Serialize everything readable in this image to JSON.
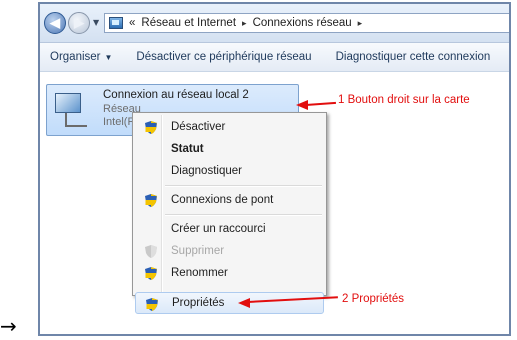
{
  "pointer_glyph": "→",
  "address_bar": {
    "prefix": "«",
    "crumbs": [
      "Réseau et Internet",
      "Connexions réseau"
    ],
    "separator": "▸"
  },
  "toolbar": {
    "organize": "Organiser",
    "disable": "Désactiver ce périphérique réseau",
    "diagnose": "Diagnostiquer cette connexion"
  },
  "adapter": {
    "name": "Connexion au réseau local 2",
    "status": "Réseau",
    "device": "Intel(R"
  },
  "context_menu": {
    "items": [
      "Désactiver",
      "Statut",
      "Diagnostiquer",
      "Connexions de pont",
      "Créer un raccourci",
      "Supprimer",
      "Renommer",
      "Propriétés"
    ]
  },
  "annotations": {
    "step1": "1 Bouton droit sur la carte",
    "step2": "2 Propriétés"
  },
  "colors": {
    "annotation": "#e20e0e",
    "highlight": "#dbe9f9",
    "frame": "#6f86a9"
  }
}
